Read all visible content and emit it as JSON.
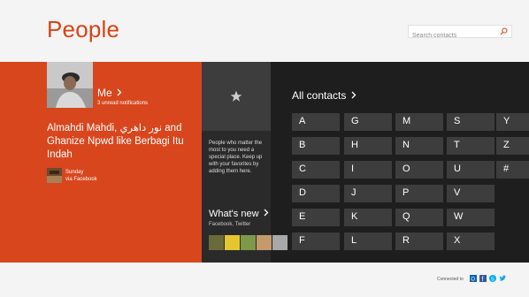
{
  "header": {
    "title": "People",
    "search_placeholder": "Search contacts"
  },
  "me": {
    "label": "Me",
    "notifications": "3 unread notifications",
    "feed_text": "Almahdi Mahdi, نور داهري and Ghanize Npwd like Berbagi Itu Indah",
    "feed_day": "Sunday",
    "feed_source": "via Facebook"
  },
  "favorites": {
    "text": "People who matter the most to you need a special place. Keep up with your favorites by adding them here."
  },
  "whats_new": {
    "title": "What's new",
    "sub": "Facebook, Twitter"
  },
  "contacts": {
    "title": "All contacts",
    "letters": [
      "A",
      "B",
      "C",
      "D",
      "E",
      "F",
      "G",
      "H",
      "I",
      "J",
      "K",
      "L",
      "M",
      "N",
      "O",
      "P",
      "Q",
      "R",
      "S",
      "T",
      "U",
      "V",
      "W",
      "X",
      "Y",
      "Z",
      "#"
    ]
  },
  "footer": {
    "connected": "Connected to"
  },
  "colors": {
    "accent": "#d8461e",
    "band": "#1e1e1e",
    "tile": "#3d3d3d"
  },
  "icons": [
    "search-icon",
    "star-icon",
    "chevron-right-icon",
    "outlook-icon",
    "facebook-icon",
    "skype-icon",
    "twitter-icon"
  ]
}
